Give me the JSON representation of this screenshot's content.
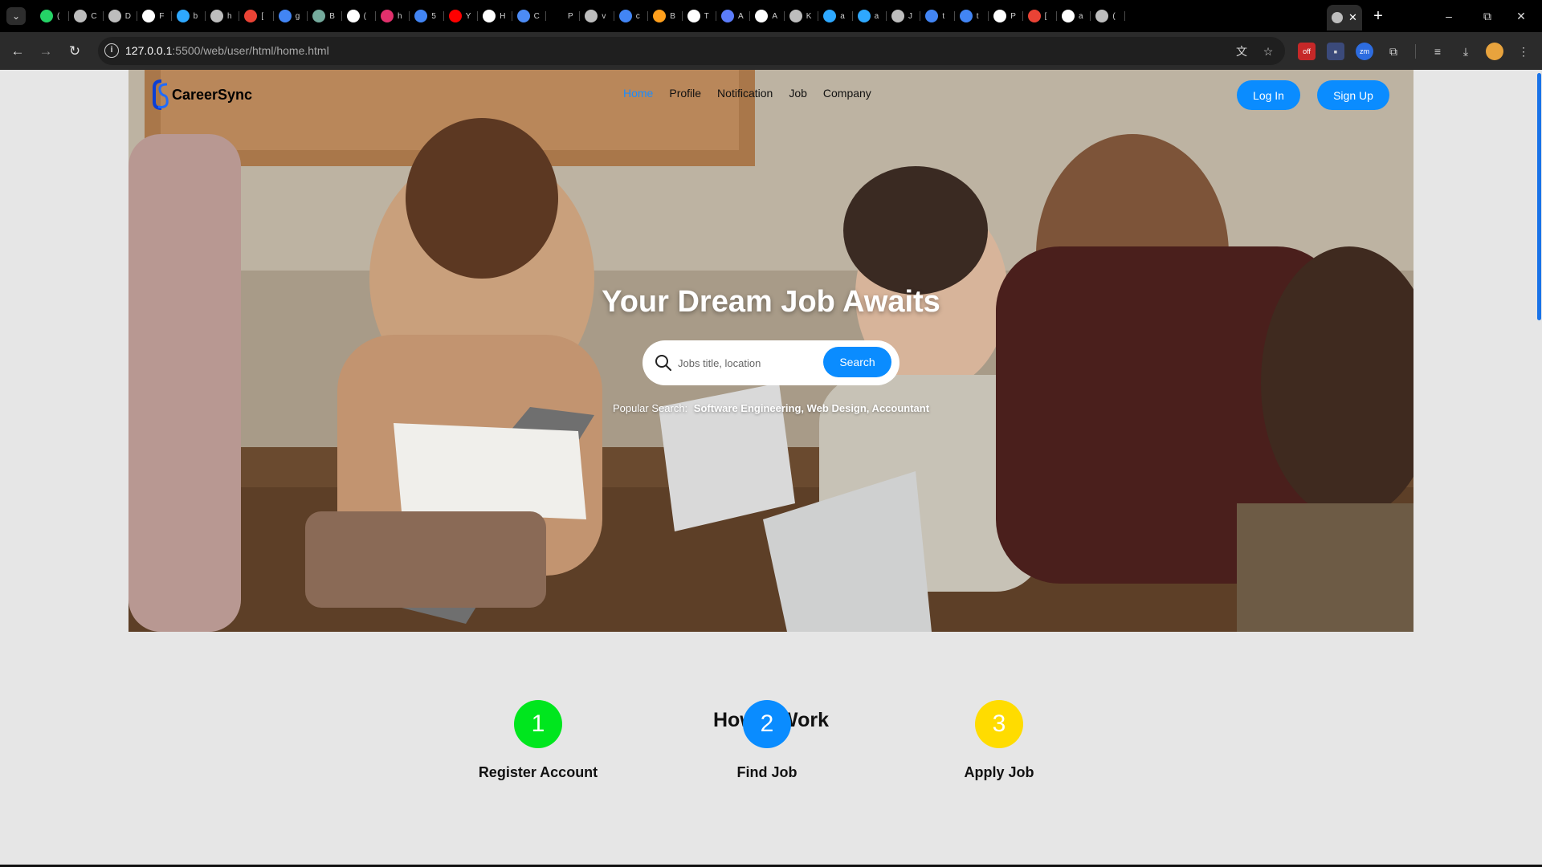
{
  "browser": {
    "tabs": [
      {
        "icon": "whatsapp-icon",
        "color": "#25d366",
        "label": "("
      },
      {
        "icon": "globe-icon",
        "color": "#bdbdbd",
        "label": "C"
      },
      {
        "icon": "globe-icon",
        "color": "#bdbdbd",
        "label": "D"
      },
      {
        "icon": "chart-icon",
        "color": "#ffffff",
        "label": "F"
      },
      {
        "icon": "play-arrow-icon",
        "color": "#2ea8ff",
        "label": "b"
      },
      {
        "icon": "globe-icon",
        "color": "#bdbdbd",
        "label": "h"
      },
      {
        "icon": "gmail-icon",
        "color": "#ea4335",
        "label": "["
      },
      {
        "icon": "google-icon",
        "color": "#4285f4",
        "label": "g"
      },
      {
        "icon": "chatgpt-icon",
        "color": "#74aa9c",
        "label": "B"
      },
      {
        "icon": "tiktok-icon",
        "color": "#ffffff",
        "label": "("
      },
      {
        "icon": "instagram-icon",
        "color": "#e1306c",
        "label": "h"
      },
      {
        "icon": "google-icon",
        "color": "#4285f4",
        "label": "5"
      },
      {
        "icon": "youtube-icon",
        "color": "#ff0000",
        "label": "Y"
      },
      {
        "icon": "download-icon",
        "color": "#ffffff",
        "label": "H"
      },
      {
        "icon": "globe-icon",
        "color": "#4c8bf5",
        "label": "C"
      },
      {
        "icon": "blank-icon",
        "color": "#000000",
        "label": "P"
      },
      {
        "icon": "globe-icon",
        "color": "#bdbdbd",
        "label": "v"
      },
      {
        "icon": "google-icon",
        "color": "#4285f4",
        "label": "c"
      },
      {
        "icon": "globe-icon",
        "color": "#ff9f1c",
        "label": "B"
      },
      {
        "icon": "globe-icon",
        "color": "#ffffff",
        "label": "T"
      },
      {
        "icon": "shield-icon",
        "color": "#5b7cfa",
        "label": "A"
      },
      {
        "icon": "github-icon",
        "color": "#ffffff",
        "label": "A"
      },
      {
        "icon": "globe-icon",
        "color": "#bdbdbd",
        "label": "K"
      },
      {
        "icon": "play-arrow-icon",
        "color": "#2ea8ff",
        "label": "a"
      },
      {
        "icon": "play-arrow-icon",
        "color": "#2ea8ff",
        "label": "a"
      },
      {
        "icon": "globe-icon",
        "color": "#bdbdbd",
        "label": "J"
      },
      {
        "icon": "google-icon",
        "color": "#4285f4",
        "label": "t"
      },
      {
        "icon": "google-icon",
        "color": "#4285f4",
        "label": "t"
      },
      {
        "icon": "github-icon",
        "color": "#ffffff",
        "label": "P"
      },
      {
        "icon": "gmail-icon",
        "color": "#ea4335",
        "label": "["
      },
      {
        "icon": "github-icon",
        "color": "#ffffff",
        "label": "a"
      },
      {
        "icon": "globe-icon",
        "color": "#bdbdbd",
        "label": "("
      }
    ],
    "active_tab_close": "✕",
    "new_tab": "+",
    "window_controls": {
      "minimize": "–",
      "restore": "⧉",
      "close": "✕"
    },
    "url_host": "127.0.0.1",
    "url_path": ":5500/web/user/html/home.html"
  },
  "site": {
    "brand_logo_text": "CS",
    "brand_name": "CareerSync",
    "nav": [
      {
        "label": "Home",
        "active": true
      },
      {
        "label": "Profile",
        "active": false
      },
      {
        "label": "Notification",
        "active": false
      },
      {
        "label": "Job",
        "active": false
      },
      {
        "label": "Company",
        "active": false
      }
    ],
    "login_label": "Log In",
    "signup_label": "Sign Up"
  },
  "hero": {
    "title": "Your Dream Job Awaits",
    "search_placeholder": "Jobs title, location",
    "search_button": "Search",
    "popular_prefix": "Popular Search:",
    "popular_items": "Software Engineering, Web Design, Accountant"
  },
  "how_it_works": {
    "title": "How it Work",
    "steps": [
      {
        "number": "1",
        "label": "Register Account",
        "color": "#00e61e"
      },
      {
        "number": "2",
        "label": "Find Job",
        "color": "#0a8cff"
      },
      {
        "number": "3",
        "label": "Apply Job",
        "color": "#ffdc00"
      }
    ]
  },
  "colors": {
    "accent": "#0a8cff",
    "nav_active": "#1a8cff"
  }
}
